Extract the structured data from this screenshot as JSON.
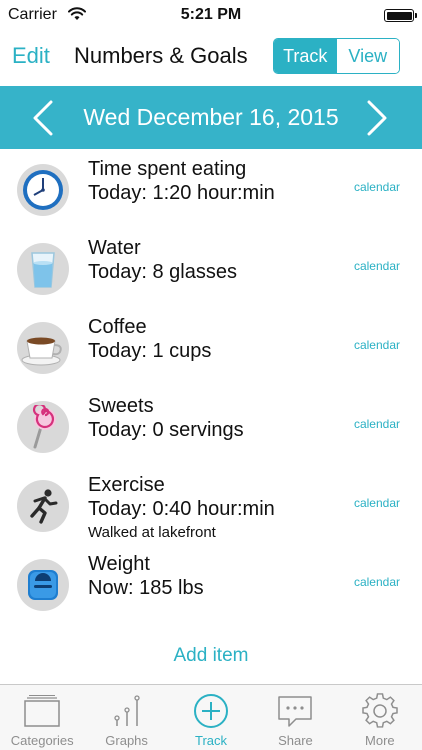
{
  "status_bar": {
    "carrier": "Carrier",
    "time": "5:21 PM"
  },
  "nav": {
    "edit_label": "Edit",
    "title": "Numbers & Goals",
    "segment": {
      "track": "Track",
      "view": "View",
      "selected": "Track"
    }
  },
  "date_bar": {
    "date": "Wed December 16, 2015"
  },
  "items": [
    {
      "name": "Time spent eating",
      "value": "Today: 1:20 hour:min",
      "note": "",
      "link": "calendar",
      "icon": "clock-icon"
    },
    {
      "name": "Water",
      "value": "Today: 8 glasses",
      "note": "",
      "link": "calendar",
      "icon": "water-glass-icon"
    },
    {
      "name": "Coffee",
      "value": "Today: 1 cups",
      "note": "",
      "link": "calendar",
      "icon": "coffee-cup-icon"
    },
    {
      "name": "Sweets",
      "value": "Today: 0 servings",
      "note": "",
      "link": "calendar",
      "icon": "lollipop-icon"
    },
    {
      "name": "Exercise",
      "value": "Today: 0:40 hour:min",
      "note": "Walked at lakefront",
      "link": "calendar",
      "icon": "runner-icon"
    },
    {
      "name": "Weight",
      "value": "Now: 185 lbs",
      "note": "",
      "link": "calendar",
      "icon": "scale-icon"
    }
  ],
  "add_item_label": "Add item",
  "tabs": [
    {
      "label": "Categories",
      "icon": "categories-icon",
      "active": false
    },
    {
      "label": "Graphs",
      "icon": "graphs-icon",
      "active": false
    },
    {
      "label": "Track",
      "icon": "plus-circle-icon",
      "active": true
    },
    {
      "label": "Share",
      "icon": "share-bubble-icon",
      "active": false
    },
    {
      "label": "More",
      "icon": "gear-icon",
      "active": false
    }
  ],
  "colors": {
    "accent": "#2bb1c4",
    "date_bar": "#36b3c9",
    "inactive_tab": "#8e8e8e"
  }
}
